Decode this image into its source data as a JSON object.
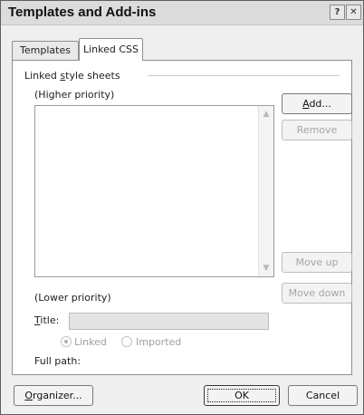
{
  "window": {
    "title": "Templates and Add-ins",
    "help_glyph": "?",
    "close_glyph": "✕"
  },
  "tabs": [
    {
      "label": "Templates"
    },
    {
      "label": "Linked CSS"
    }
  ],
  "group": {
    "label_pre": "Linked ",
    "label_access": "s",
    "label_post": "tyle sheets"
  },
  "list": {
    "higher_priority": "(Higher priority)",
    "lower_priority": "(Lower priority)",
    "scroll_up_glyph": "▲",
    "scroll_down_glyph": "▼"
  },
  "buttons": {
    "add_access": "A",
    "add_rest": "dd...",
    "remove": "Remove",
    "move_up": "Move up",
    "move_down": "Move down",
    "organizer_access": "O",
    "organizer_rest": "rganizer...",
    "ok": "OK",
    "cancel": "Cancel"
  },
  "title_field": {
    "label_access": "T",
    "label_rest": "itle:",
    "value": ""
  },
  "radio": {
    "linked": "Linked",
    "imported": "Imported",
    "selected": "linked"
  },
  "full_path": {
    "label": "Full path:",
    "value": ""
  }
}
